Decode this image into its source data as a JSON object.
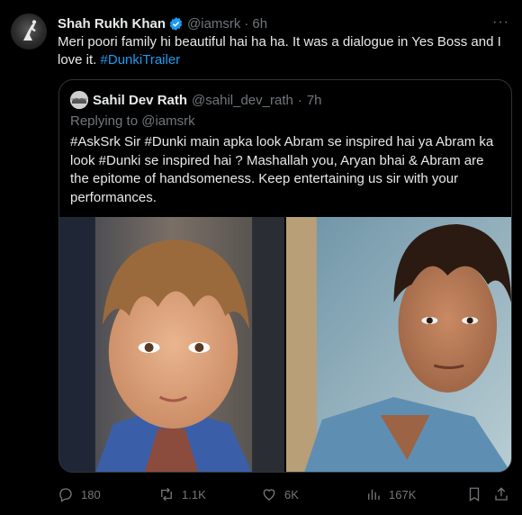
{
  "tweet": {
    "author_name": "Shah Rukh Khan",
    "author_handle": "@iamsrk",
    "separator": "·",
    "time": "6h",
    "more": "···",
    "text_main": "Meri poori family hi beautiful hai ha ha. It was a dialogue in Yes Boss and I love it. ",
    "text_hashtag": "#DunkiTrailer"
  },
  "quote": {
    "author_name": "Sahil Dev Rath",
    "author_handle": "@sahil_dev_rath",
    "separator": "·",
    "time": "7h",
    "replying_to": "Replying to @iamsrk",
    "text": "#AskSrk Sir #Dunki main apka look Abram se inspired hai ya Abram ka look #Dunki se inspired hai ? Mashallah you, Aryan bhai & Abram are the epitome of handsomeness. Keep entertaining us sir with your performances."
  },
  "actions": {
    "replies": "180",
    "retweets": "1.1K",
    "likes": "6K",
    "views": "167K"
  },
  "icons": {
    "verified": "verified-badge-icon",
    "reply": "reply-icon",
    "retweet": "retweet-icon",
    "like": "heart-icon",
    "views": "views-icon",
    "bookmark": "bookmark-icon",
    "share": "share-icon"
  },
  "colors": {
    "background": "#000000",
    "text": "#e7e9ea",
    "secondary": "#71767b",
    "accent": "#1d9bf0",
    "border": "#2f3336"
  }
}
